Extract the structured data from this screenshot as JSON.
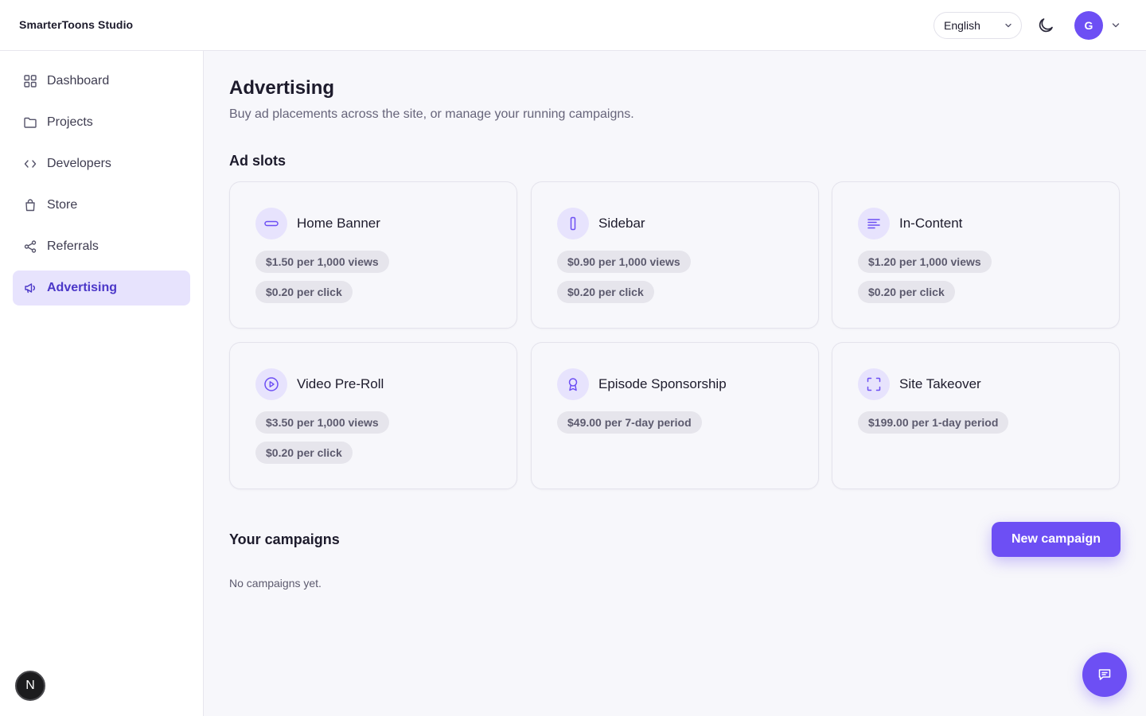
{
  "header": {
    "brand": "SmarterToons Studio",
    "language": "English",
    "avatar_initial": "G"
  },
  "sidebar": {
    "items": [
      {
        "label": "Dashboard",
        "icon": "grid-icon"
      },
      {
        "label": "Projects",
        "icon": "folder-icon"
      },
      {
        "label": "Developers",
        "icon": "code-icon"
      },
      {
        "label": "Store",
        "icon": "shopping-bag-icon"
      },
      {
        "label": "Referrals",
        "icon": "share-icon"
      },
      {
        "label": "Advertising",
        "icon": "megaphone-icon",
        "active": true
      }
    ],
    "badge": "N"
  },
  "main": {
    "title": "Advertising",
    "subtitle": "Buy ad placements across the site, or manage your running campaigns.",
    "ad_slots_title": "Ad slots",
    "slots": [
      {
        "name": "Home Banner",
        "icon": "banner-icon",
        "prices": [
          "$1.50 per 1,000 views",
          "$0.20 per click"
        ]
      },
      {
        "name": "Sidebar",
        "icon": "sidebar-icon",
        "prices": [
          "$0.90 per 1,000 views",
          "$0.20 per click"
        ]
      },
      {
        "name": "In-Content",
        "icon": "text-lines-icon",
        "prices": [
          "$1.20 per 1,000 views",
          "$0.20 per click"
        ]
      },
      {
        "name": "Video Pre-Roll",
        "icon": "play-circle-icon",
        "prices": [
          "$3.50 per 1,000 views",
          "$0.20 per click"
        ]
      },
      {
        "name": "Episode Sponsorship",
        "icon": "award-icon",
        "prices": [
          "$49.00 per 7-day period"
        ]
      },
      {
        "name": "Site Takeover",
        "icon": "fullscreen-icon",
        "prices": [
          "$199.00 per 1-day period"
        ]
      }
    ],
    "campaigns_title": "Your campaigns",
    "new_campaign_label": "New campaign",
    "empty_text": "No campaigns yet."
  },
  "colors": {
    "accent": "#6d4ff4",
    "accent_soft": "#e7e3fd",
    "background": "#f7f7fb"
  }
}
